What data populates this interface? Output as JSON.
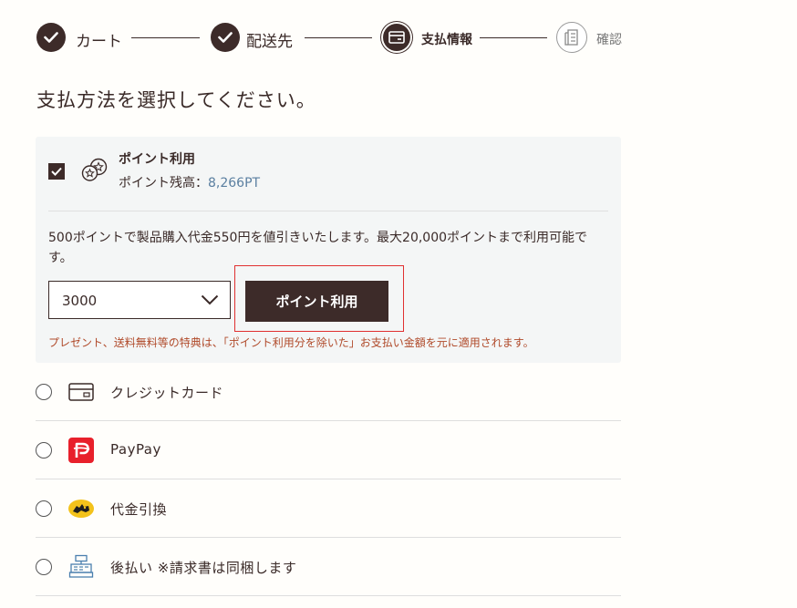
{
  "stepper": {
    "steps": [
      {
        "label": "カート",
        "state": "done"
      },
      {
        "label": "配送先",
        "state": "done"
      },
      {
        "label": "支払情報",
        "state": "current"
      },
      {
        "label": "確認",
        "state": "future"
      }
    ]
  },
  "heading": "支払方法を選択してください。",
  "points": {
    "title": "ポイント利用",
    "balance_label": "ポイント残高：",
    "balance_value": "8,266PT",
    "description": "500ポイントで製品購入代金550円を値引きいたします。最大20,000ポイントまで利用可能です。",
    "select_value": "3000",
    "apply_label": "ポイント利用",
    "note": "プレゼント、送料無料等の特典は、「ポイント利用分を除いた」お支払い金額を元に適用されます。"
  },
  "methods": [
    {
      "label": "クレジットカード",
      "icon": "credit-card-icon"
    },
    {
      "label": "PayPay",
      "icon": "paypay-icon"
    },
    {
      "label": "代金引換",
      "icon": "yamato-cat-icon"
    },
    {
      "label": "後払い ※請求書は同梱します",
      "icon": "invoice-register-icon"
    }
  ],
  "colors": {
    "primary": "#3d2b29",
    "accent_text": "#5a7fa0",
    "note_text": "#b04a2a",
    "highlight": "#e03030",
    "paypay_red": "#e8202b"
  }
}
